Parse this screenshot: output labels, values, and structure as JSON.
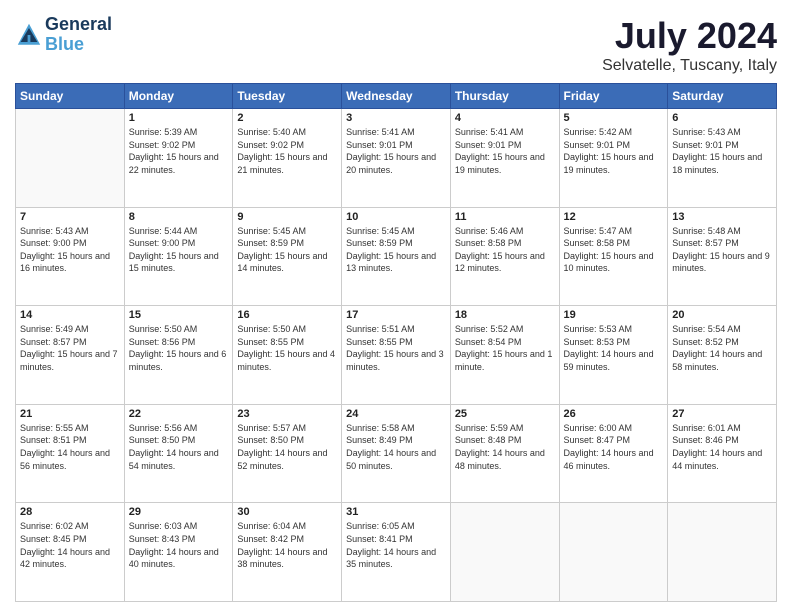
{
  "header": {
    "logo_line1": "General",
    "logo_line2": "Blue",
    "title": "July 2024",
    "subtitle": "Selvatelle, Tuscany, Italy"
  },
  "columns": [
    "Sunday",
    "Monday",
    "Tuesday",
    "Wednesday",
    "Thursday",
    "Friday",
    "Saturday"
  ],
  "weeks": [
    [
      {
        "day": "",
        "empty": true
      },
      {
        "day": "1",
        "sunrise": "5:39 AM",
        "sunset": "9:02 PM",
        "daylight": "15 hours and 22 minutes."
      },
      {
        "day": "2",
        "sunrise": "5:40 AM",
        "sunset": "9:02 PM",
        "daylight": "15 hours and 21 minutes."
      },
      {
        "day": "3",
        "sunrise": "5:41 AM",
        "sunset": "9:01 PM",
        "daylight": "15 hours and 20 minutes."
      },
      {
        "day": "4",
        "sunrise": "5:41 AM",
        "sunset": "9:01 PM",
        "daylight": "15 hours and 19 minutes."
      },
      {
        "day": "5",
        "sunrise": "5:42 AM",
        "sunset": "9:01 PM",
        "daylight": "15 hours and 19 minutes."
      },
      {
        "day": "6",
        "sunrise": "5:43 AM",
        "sunset": "9:01 PM",
        "daylight": "15 hours and 18 minutes."
      }
    ],
    [
      {
        "day": "7",
        "sunrise": "5:43 AM",
        "sunset": "9:00 PM",
        "daylight": "15 hours and 16 minutes."
      },
      {
        "day": "8",
        "sunrise": "5:44 AM",
        "sunset": "9:00 PM",
        "daylight": "15 hours and 15 minutes."
      },
      {
        "day": "9",
        "sunrise": "5:45 AM",
        "sunset": "8:59 PM",
        "daylight": "15 hours and 14 minutes."
      },
      {
        "day": "10",
        "sunrise": "5:45 AM",
        "sunset": "8:59 PM",
        "daylight": "15 hours and 13 minutes."
      },
      {
        "day": "11",
        "sunrise": "5:46 AM",
        "sunset": "8:58 PM",
        "daylight": "15 hours and 12 minutes."
      },
      {
        "day": "12",
        "sunrise": "5:47 AM",
        "sunset": "8:58 PM",
        "daylight": "15 hours and 10 minutes."
      },
      {
        "day": "13",
        "sunrise": "5:48 AM",
        "sunset": "8:57 PM",
        "daylight": "15 hours and 9 minutes."
      }
    ],
    [
      {
        "day": "14",
        "sunrise": "5:49 AM",
        "sunset": "8:57 PM",
        "daylight": "15 hours and 7 minutes."
      },
      {
        "day": "15",
        "sunrise": "5:50 AM",
        "sunset": "8:56 PM",
        "daylight": "15 hours and 6 minutes."
      },
      {
        "day": "16",
        "sunrise": "5:50 AM",
        "sunset": "8:55 PM",
        "daylight": "15 hours and 4 minutes."
      },
      {
        "day": "17",
        "sunrise": "5:51 AM",
        "sunset": "8:55 PM",
        "daylight": "15 hours and 3 minutes."
      },
      {
        "day": "18",
        "sunrise": "5:52 AM",
        "sunset": "8:54 PM",
        "daylight": "15 hours and 1 minute."
      },
      {
        "day": "19",
        "sunrise": "5:53 AM",
        "sunset": "8:53 PM",
        "daylight": "14 hours and 59 minutes."
      },
      {
        "day": "20",
        "sunrise": "5:54 AM",
        "sunset": "8:52 PM",
        "daylight": "14 hours and 58 minutes."
      }
    ],
    [
      {
        "day": "21",
        "sunrise": "5:55 AM",
        "sunset": "8:51 PM",
        "daylight": "14 hours and 56 minutes."
      },
      {
        "day": "22",
        "sunrise": "5:56 AM",
        "sunset": "8:50 PM",
        "daylight": "14 hours and 54 minutes."
      },
      {
        "day": "23",
        "sunrise": "5:57 AM",
        "sunset": "8:50 PM",
        "daylight": "14 hours and 52 minutes."
      },
      {
        "day": "24",
        "sunrise": "5:58 AM",
        "sunset": "8:49 PM",
        "daylight": "14 hours and 50 minutes."
      },
      {
        "day": "25",
        "sunrise": "5:59 AM",
        "sunset": "8:48 PM",
        "daylight": "14 hours and 48 minutes."
      },
      {
        "day": "26",
        "sunrise": "6:00 AM",
        "sunset": "8:47 PM",
        "daylight": "14 hours and 46 minutes."
      },
      {
        "day": "27",
        "sunrise": "6:01 AM",
        "sunset": "8:46 PM",
        "daylight": "14 hours and 44 minutes."
      }
    ],
    [
      {
        "day": "28",
        "sunrise": "6:02 AM",
        "sunset": "8:45 PM",
        "daylight": "14 hours and 42 minutes."
      },
      {
        "day": "29",
        "sunrise": "6:03 AM",
        "sunset": "8:43 PM",
        "daylight": "14 hours and 40 minutes."
      },
      {
        "day": "30",
        "sunrise": "6:04 AM",
        "sunset": "8:42 PM",
        "daylight": "14 hours and 38 minutes."
      },
      {
        "day": "31",
        "sunrise": "6:05 AM",
        "sunset": "8:41 PM",
        "daylight": "14 hours and 35 minutes."
      },
      {
        "day": "",
        "empty": true
      },
      {
        "day": "",
        "empty": true
      },
      {
        "day": "",
        "empty": true
      }
    ]
  ]
}
